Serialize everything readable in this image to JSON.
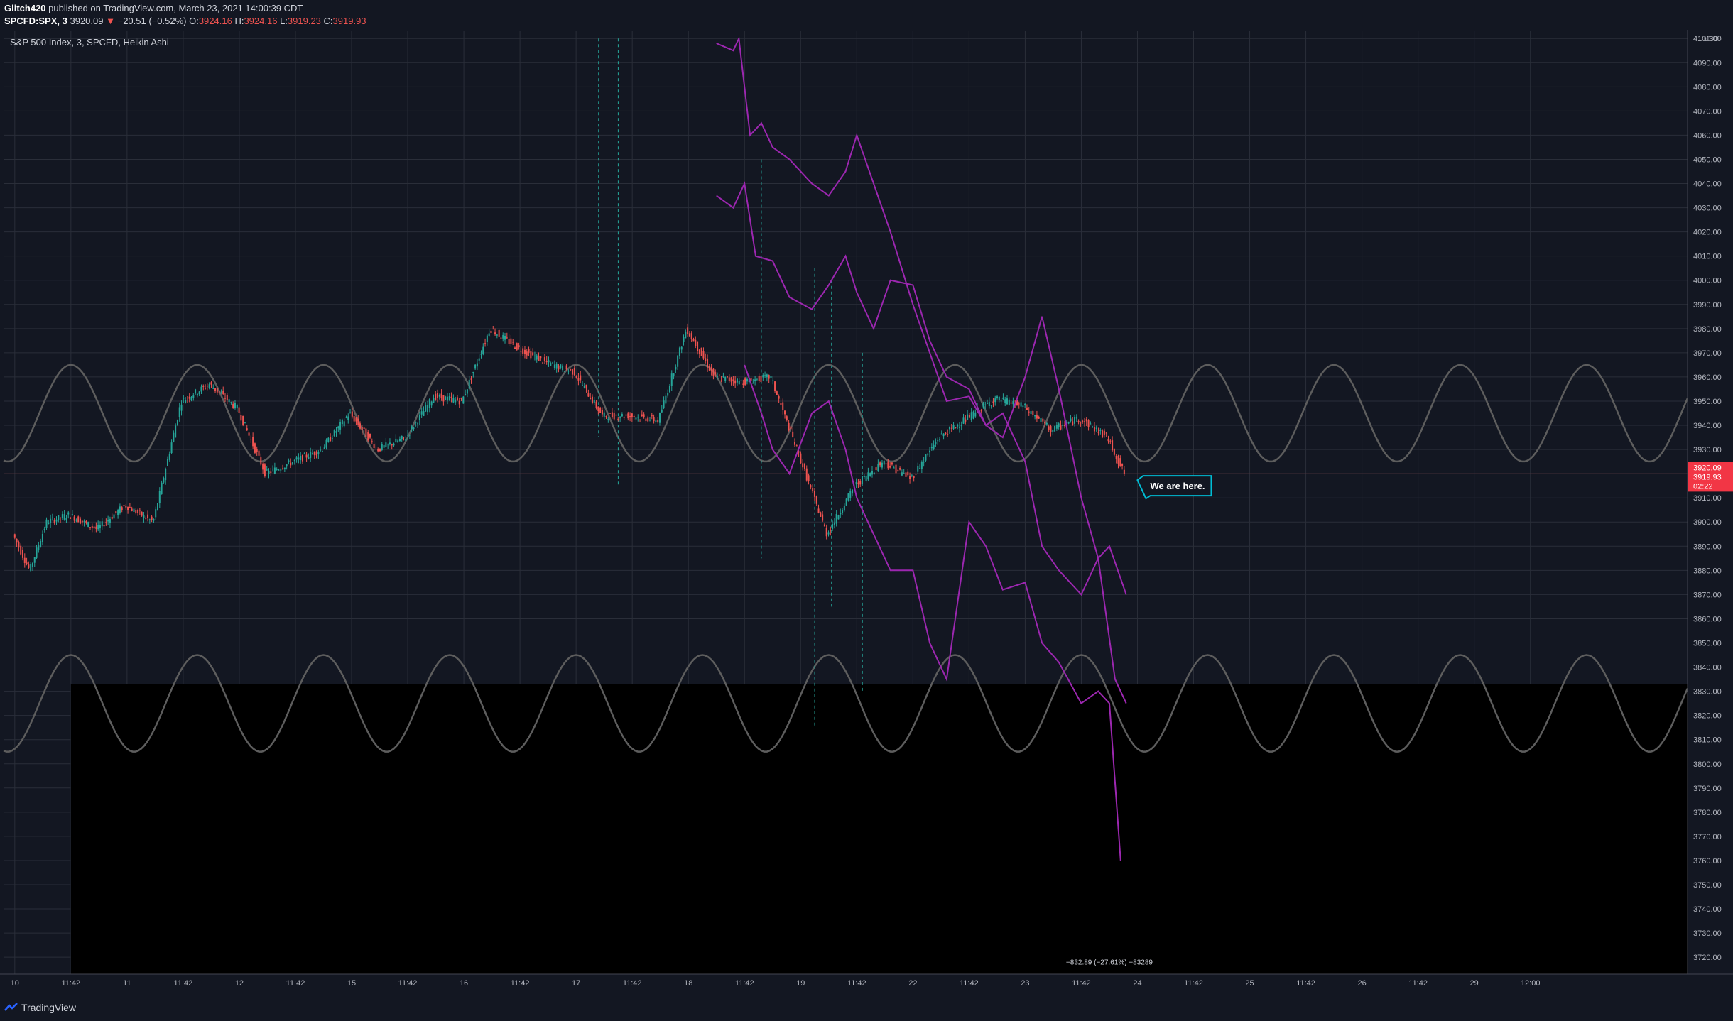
{
  "header": {
    "author": "Glitch420",
    "published": "published on TradingView.com, March 23, 2021 14:00:39 CDT",
    "symbol": "SPCFD:SPX, 3",
    "last": "3920.09",
    "change": "−20.51 (−0.52%)",
    "o_label": "O:",
    "o_val": "3924.16",
    "h_label": "H:",
    "h_val": "3924.16",
    "l_label": "L:",
    "l_val": "3919.23",
    "c_label": "C:",
    "c_val": "3919.93"
  },
  "chart_title": "S&P 500 Index, 3, SPCFD, Heikin Ashi",
  "annotation": "We are here.",
  "measure_label": "−832.89 (−27.61%) −83289",
  "price_badges": {
    "last": "3920.09",
    "close": "3919.93",
    "timer": "02:22"
  },
  "footer": {
    "brand": "TradingView"
  },
  "colors": {
    "background": "#131722",
    "grid": "#2a2e39",
    "bull": "#26a69a",
    "bear": "#ef5350",
    "projection": "#9c27b0",
    "sine": "#5d5d5d",
    "annotation_border": "#00bcd4",
    "badge": "#f23645"
  },
  "chart_data": {
    "type": "line",
    "title": "S&P 500 Index, 3, SPCFD, Heikin Ashi",
    "ylabel": "USD",
    "ylim": [
      3713,
      4103
    ],
    "y_ticks": [
      3720,
      3730,
      3740,
      3750,
      3760,
      3770,
      3780,
      3790,
      3800,
      3810,
      3820,
      3830,
      3840,
      3850,
      3860,
      3870,
      3880,
      3890,
      3900,
      3910,
      3920,
      3930,
      3940,
      3950,
      3960,
      3970,
      3980,
      3990,
      4000,
      4010,
      4020,
      4030,
      4040,
      4050,
      4060,
      4070,
      4080,
      4090,
      4100
    ],
    "y_tick_labels": [
      "3720.00",
      "3730.00",
      "3740.00",
      "3750.00",
      "3760.00",
      "3770.00",
      "3780.00",
      "3790.00",
      "3800.00",
      "3810.00",
      "3820.00",
      "3830.00",
      "3840.00",
      "3850.00",
      "3860.00",
      "3870.00",
      "3880.00",
      "3890.00",
      "3900.00",
      "3910.00",
      "3920.00",
      "3930.00",
      "3940.00",
      "3950.00",
      "3960.00",
      "3970.00",
      "3980.00",
      "3990.00",
      "4000.00",
      "4010.00",
      "4020.00",
      "4030.00",
      "4040.00",
      "4050.00",
      "4060.00",
      "4070.00",
      "4080.00",
      "4090.00",
      "4100.00"
    ],
    "x_ticks": [
      0,
      1,
      2,
      3,
      4,
      5,
      6,
      7,
      8,
      9,
      10,
      11,
      12,
      13,
      14,
      15,
      16,
      17,
      18,
      19,
      20,
      21,
      22,
      23,
      24,
      25,
      26,
      27
    ],
    "x_tick_labels": [
      "10",
      "11:42",
      "11",
      "11:42",
      "12",
      "11:42",
      "15",
      "11:42",
      "16",
      "11:42",
      "17",
      "11:42",
      "18",
      "11:42",
      "19",
      "11:42",
      "22",
      "11:42",
      "23",
      "11:42",
      "24",
      "11:42",
      "25",
      "11:42",
      "26",
      "11:42",
      "29",
      "12:00"
    ],
    "xlim": [
      -0.2,
      29.8
    ],
    "current_price": 3919.93,
    "price_series": {
      "name": "SPX Heikin Ashi (approx.)",
      "x": [
        0,
        0.3,
        0.6,
        1,
        1.5,
        2,
        2.5,
        3,
        3.5,
        4,
        4.5,
        5,
        5.5,
        6,
        6.5,
        7,
        7.5,
        8,
        8.5,
        9,
        9.5,
        10,
        10.5,
        11,
        11.5,
        12,
        12.5,
        13,
        13.5,
        14,
        14.5,
        15,
        15.5,
        16,
        16.5,
        17,
        17.5,
        18,
        18.5,
        19,
        19.5,
        19.8
      ],
      "y": [
        3895,
        3880,
        3900,
        3903,
        3897,
        3907,
        3900,
        3950,
        3957,
        3947,
        3920,
        3925,
        3930,
        3945,
        3930,
        3935,
        3952,
        3950,
        3980,
        3972,
        3966,
        3962,
        3944,
        3944,
        3942,
        3980,
        3960,
        3958,
        3960,
        3928,
        3895,
        3915,
        3925,
        3918,
        3935,
        3943,
        3951,
        3948,
        3938,
        3943,
        3935,
        3920
      ]
    },
    "projection_series": [
      {
        "x": [
          12.5,
          12.8,
          12.9,
          13.1,
          13.3,
          13.5,
          13.8,
          14.2,
          14.5,
          14.8,
          15.0,
          15.3,
          15.6,
          16.0,
          16.3,
          16.6,
          17.0,
          17.3,
          17.6,
          18.0,
          18.3,
          18.6,
          19.0,
          19.3,
          19.6,
          19.8
        ],
        "y": [
          4098,
          4095,
          4100,
          4060,
          4065,
          4055,
          4050,
          4040,
          4035,
          4045,
          4060,
          4040,
          4020,
          3990,
          3970,
          3950,
          3952,
          3940,
          3945,
          3925,
          3890,
          3880,
          3870,
          3885,
          3835,
          3825
        ]
      },
      {
        "x": [
          12.5,
          12.8,
          13.0,
          13.2,
          13.5,
          13.8,
          14.2,
          14.5,
          14.8,
          15.0,
          15.3,
          15.6,
          16.0,
          16.3,
          16.6,
          17.0,
          17.3,
          17.6,
          18.0,
          18.3,
          18.6,
          19.0,
          19.3,
          19.5,
          19.8
        ],
        "y": [
          4035,
          4030,
          4040,
          4010,
          4008,
          3993,
          3988,
          3998,
          4010,
          3995,
          3980,
          4000,
          3998,
          3975,
          3960,
          3955,
          3940,
          3935,
          3960,
          3985,
          3955,
          3910,
          3885,
          3890,
          3870
        ]
      },
      {
        "x": [
          13.0,
          13.3,
          13.5,
          13.8,
          14.2,
          14.5,
          14.8,
          15.0,
          15.3,
          15.6,
          16.0,
          16.3,
          16.6,
          17.0,
          17.3,
          17.6,
          18.0,
          18.3,
          18.6,
          19.0,
          19.3,
          19.5,
          19.7
        ],
        "y": [
          3965,
          3945,
          3930,
          3920,
          3945,
          3950,
          3930,
          3910,
          3895,
          3880,
          3880,
          3850,
          3835,
          3900,
          3890,
          3872,
          3875,
          3850,
          3842,
          3825,
          3830,
          3825,
          3760
        ]
      }
    ],
    "cycle_upper": {
      "amplitude": 20,
      "center": 3945,
      "period_days": 2.25
    },
    "cycle_lower": {
      "amplitude": 20,
      "center": 3825,
      "period_days": 2.25
    }
  }
}
